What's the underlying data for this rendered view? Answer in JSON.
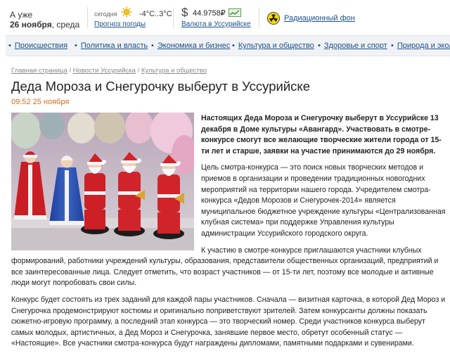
{
  "header": {
    "date_label": "А уже",
    "date_value": "26 ноября",
    "weekday": ", среда",
    "weather": {
      "label": "сегодня",
      "temp": "-4°C..3°C",
      "forecast_link": "Прогноз погоды",
      "icon": "sun-icon"
    },
    "currency": {
      "symbol": "$",
      "value": "44.9758₽",
      "link": "Валюта в Уссурийске",
      "icon": "chart-up-icon"
    },
    "radiation": {
      "link": "Радиационный фон",
      "icon": "radiation-icon"
    }
  },
  "nav": {
    "items": [
      {
        "label": "Происшествия"
      },
      {
        "label": "Политика и власть"
      },
      {
        "label": "Экономика и бизнес"
      },
      {
        "label": "Культура и общество"
      },
      {
        "label": "Здоровье и спорт"
      },
      {
        "label": "Природа и эколо"
      }
    ]
  },
  "breadcrumb": {
    "items": [
      "Главная страница",
      "Новости Уссурийска",
      "Культура и общество"
    ],
    "separator": " / "
  },
  "article": {
    "title": "Деда Мороза и Снегурочку выберут в Уссурийске",
    "time": "09:52",
    "date": "25 ноября",
    "paragraphs": [
      "Настоящих Деда Мороза и Снегурочку выберут в Уссурийске 13 декабря в Доме культуры «Авангард». Участвовать в смотре-конкурсе смогут все желающие творческие жители города от 15-ти лет и старше, заявки на участие принимаются до 29 ноября.",
      "Цель смотра-конкурса — это поиск новых творческих методов и приемов в организации и проведении традиционных новогодних мероприятий на территории нашего города. Учредителем смотра-конкурса «Дедов Морозов и Снегурочек-2014» является муниципальное бюджетное учреждение культуры «Централизованная клубная система» при поддержке Управления культуры администрации Уссурийского городского округа.",
      "К участию в смотре-конкурсе приглашаются участники клубных формирований, работники учреждений культуры, образования, представители общественных организаций, предприятий и все заинтересованные лица. Следует отметить, что возраст участников — от 15-ти лет, поэтому все молодые и активные люди могут попробовать свои силы.",
      "Конкурс будет состоять из трех заданий для каждой пары участников. Сначала — визитная карточка, в которой Дед Мороз и Снегурочка продемонстрируют костюмы и оригинально поприветствуют зрителей. Затем конкурсанты должны показать сюжетно-игровую программу, а последний этап конкурса — это творческий номер. Среди участников конкурса выберут самых молодых, артистичных, а Дед Мороз и Снегурочка, занявшие первое место, обретут особенный статус — «Настоящие». Все участники смотра-конкурса будут награждены дипломами, памятными подарками и сувенирами."
    ]
  },
  "colors": {
    "link": "#1a4f8c",
    "date_accent": "#d86a1a",
    "nav_bg": "#f0f2f5"
  }
}
